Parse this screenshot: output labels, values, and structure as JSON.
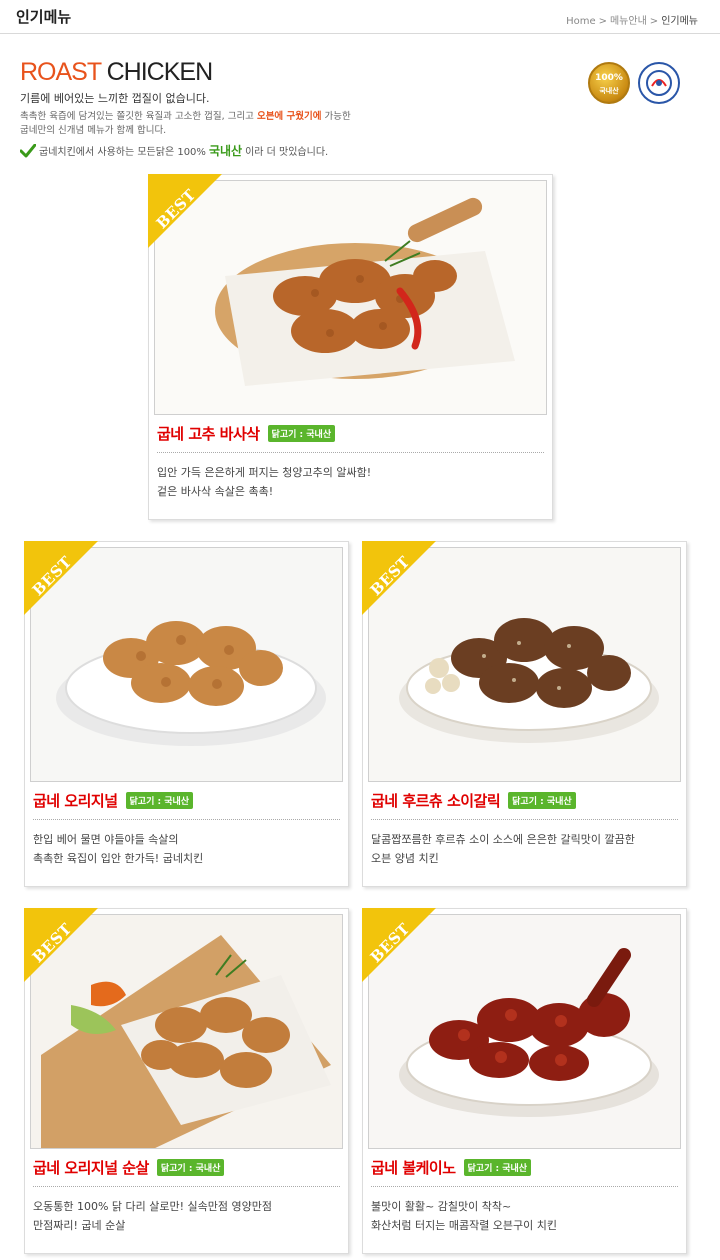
{
  "header": {
    "title": "인기메뉴",
    "breadcrumb": [
      "Home",
      "메뉴안내",
      "인기메뉴"
    ],
    "separator": ">"
  },
  "intro": {
    "title_accent": "ROAST",
    "title_main": "CHICKEN",
    "headline": "기름에 베어있는 느끼한 껍질이 없습니다.",
    "desc_part1": "촉촉한 육즙에 담겨있는 쫄깃한 육질과 고소한 껍질, 그리고 ",
    "desc_highlight": "오븐에 구웠기에",
    "desc_part2": " 가능한",
    "desc_line2": "굽네만의 신개념 메뉴가 함께 합니다.",
    "check_before": "굽네치킨에서 사용하는 모든닭은 100%",
    "check_origin": "국내산",
    "check_after": "이라 더 맛있습니다.",
    "badge_1_percent": "100%",
    "badge_1_label": "국내산",
    "accent_color": "#e8531c",
    "origin_color": "#3a9a1a"
  },
  "best_label": "BEST",
  "menus": [
    {
      "name": "굽네 고추 바사삭",
      "origin": "닭고기 : 국내산",
      "desc": [
        "입안 가득 은은하게 퍼지는 청양고추의 알싸함!",
        "겉은 바사삭 속살은 촉촉!"
      ],
      "image": "hot-pepper-chicken-on-board"
    },
    {
      "name": "굽네 오리지널",
      "origin": "닭고기 : 국내산",
      "desc": [
        "한입 베어 물면 야들야들 속살의",
        "촉촉한 육집이 입안 한가득! 굽네치킨"
      ],
      "image": "original-roast-chicken-on-plate"
    },
    {
      "name": "굽네 후르츄 소이갈릭",
      "origin": "닭고기 : 국내산",
      "desc": [
        "달콤짭쪼름한 후르츄 소이 소스에 은은한 갈릭맛이 깔끔한",
        "오븐 양념 치킨"
      ],
      "image": "soy-garlic-chicken-on-plate"
    },
    {
      "name": "굽네 오리지널 순살",
      "origin": "닭고기 : 국내산",
      "desc": [
        "오동통한 100% 닭 다리 살로만! 실속만점 영양만점",
        "만점짜리! 굽네 순살"
      ],
      "image": "boneless-chicken-on-board"
    },
    {
      "name": "굽네 볼케이노",
      "origin": "닭고기 : 국내산",
      "desc": [
        "불맛이 활활~ 감칠맛이 착착~",
        "화산처럼 터지는 매콤작렬 오븐구이 치킨"
      ],
      "image": "volcano-chicken-on-plate"
    }
  ],
  "colors": {
    "menu_name": "#e00000",
    "origin_tag": "#5ab52c",
    "best_ribbon": "#f2c40c"
  }
}
